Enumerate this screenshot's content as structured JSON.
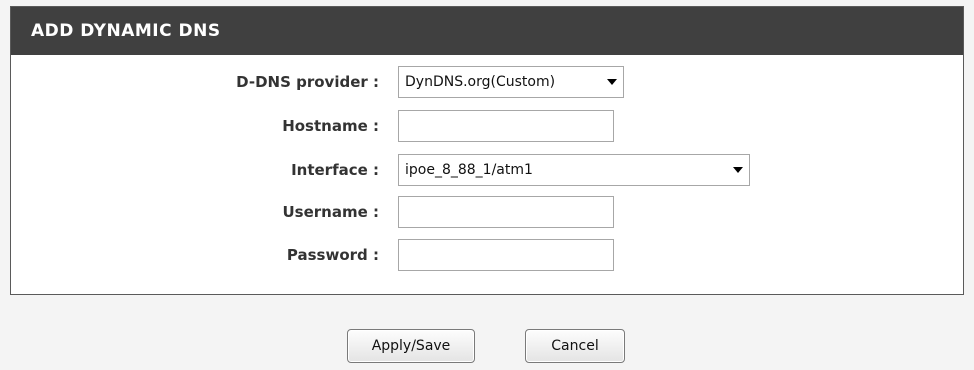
{
  "panel": {
    "title": "ADD DYNAMIC DNS"
  },
  "form": {
    "provider": {
      "label": "D-DNS provider :",
      "value": "DynDNS.org(Custom)"
    },
    "hostname": {
      "label": "Hostname :",
      "value": ""
    },
    "interface": {
      "label": "Interface :",
      "value": "ipoe_8_88_1/atm1"
    },
    "username": {
      "label": "Username :",
      "value": ""
    },
    "password": {
      "label": "Password :",
      "value": ""
    }
  },
  "buttons": {
    "apply_save": "Apply/Save",
    "cancel": "Cancel"
  },
  "icons": {
    "dropdown": "chevron-down-icon"
  },
  "colors": {
    "header_bg": "#404040",
    "header_text": "#ffffff",
    "page_bg": "#f4f4f4",
    "label_text": "#333333"
  }
}
